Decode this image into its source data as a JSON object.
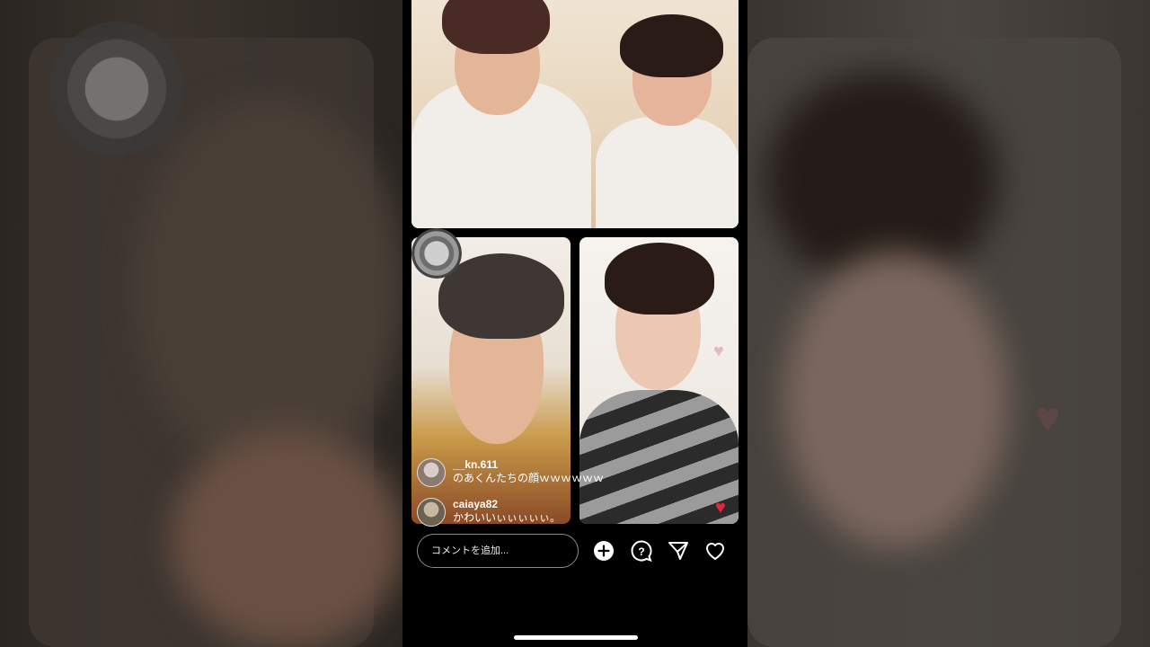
{
  "live": {
    "comments": [
      {
        "user": "__kn.611",
        "text": "のあくんたちの顔ｗｗｗｗｗｗ"
      },
      {
        "user": "caiaya82",
        "text": "かわいいぃぃぃぃぃ。"
      }
    ],
    "comment_input": {
      "placeholder": "コメントを追加..."
    },
    "actions": {
      "add_icon": "plus-circle-icon",
      "question_icon": "question-bubble-icon",
      "send_icon": "paper-plane-icon",
      "like_icon": "heart-outline-icon"
    },
    "colors": {
      "like_heart": "#e3263b",
      "background": "#000000"
    }
  }
}
